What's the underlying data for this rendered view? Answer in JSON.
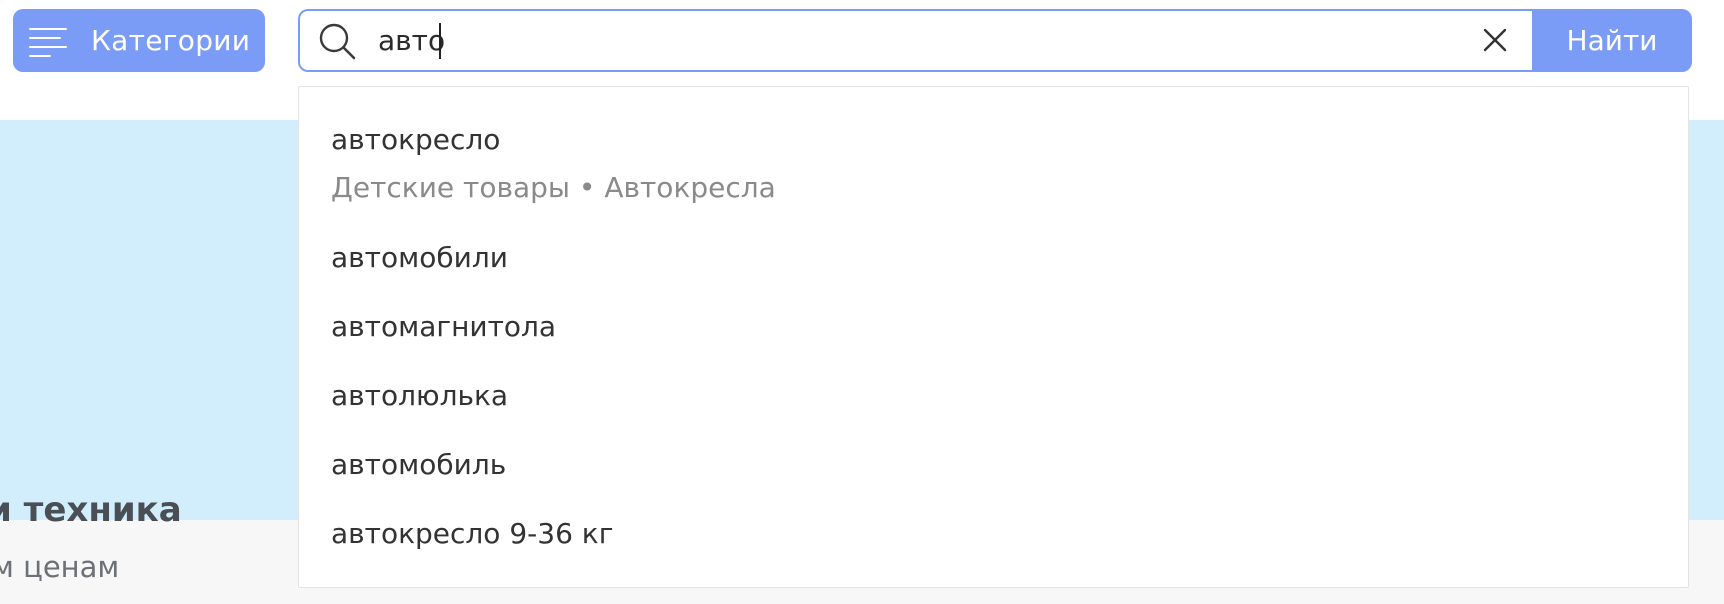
{
  "header": {
    "categories_label": "Категории",
    "search": {
      "value": "авто",
      "placeholder": ""
    },
    "find_label": "Найти"
  },
  "banner": {
    "title": "и техника",
    "subtitle": "м ценам"
  },
  "suggestions": [
    {
      "text": "автокресло",
      "category": "Детские товары • Автокресла"
    },
    {
      "text": "автомобили"
    },
    {
      "text": "автомагнитола"
    },
    {
      "text": "автолюлька"
    },
    {
      "text": "автомобиль"
    },
    {
      "text": "автокресло 9-36 кг"
    }
  ],
  "colors": {
    "accent": "#7b9cf6",
    "banner_bg": "#d2edfb"
  }
}
